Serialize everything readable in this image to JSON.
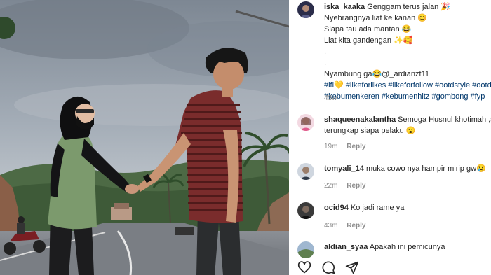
{
  "post": {
    "caption": {
      "username": "iska_kaaka",
      "lines": [
        "Genggam terus jalan 🎉",
        "Nyebrangnya liat ke kanan 😊",
        "Siapa tau ada mantan 😂",
        "Liat kita gandengan ✨🥰",
        ".",
        ".",
        "Nyambung ga😂@_ardianzt11"
      ],
      "hashtags_line1": "#lfl💛 #likeforlikes #likeforfollow #ootdstyle #ootdfa",
      "hashtags_line2": "#kebumenkeren #kebumenhitz #gombong #fyp",
      "time": "43w"
    },
    "comments": [
      {
        "username": "shaqueenakalantha",
        "text_line1": "Semoga Husnul khotimah ,sege",
        "text_line2": "terungkap siapa pelaku 😮",
        "time": "19m",
        "reply": "Reply"
      },
      {
        "username": "tomyali_14",
        "text_line1": "muka cowo nya hampir mirip gw😢",
        "time": "22m",
        "reply": "Reply"
      },
      {
        "username": "ocid94",
        "text_line1": "Ko jadi rame ya",
        "time": "43m",
        "reply": "Reply"
      },
      {
        "username": "aldian_syaa",
        "text_line1": "Apakah ini pemicunya"
      }
    ],
    "actions": [
      "heart-icon",
      "comment-icon",
      "share-icon"
    ]
  }
}
